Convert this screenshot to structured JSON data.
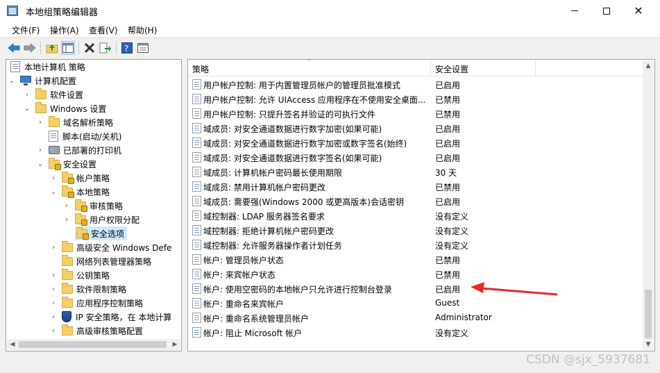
{
  "window": {
    "title": "本地组策略编辑器"
  },
  "menu": [
    "文件(F)",
    "操作(A)",
    "查看(V)",
    "帮助(H)"
  ],
  "toolbar_icons": [
    "back-arrow-icon",
    "forward-arrow-icon",
    "up-folder-icon",
    "show-tree-icon",
    "delete-icon",
    "export-icon",
    "help-icon",
    "properties-icon"
  ],
  "tree": [
    {
      "label": "本地计算机 策略",
      "icon": "policy-icon"
    },
    {
      "label": "计算机配置",
      "icon": "computer-icon"
    },
    {
      "label": "软件设置",
      "icon": "folder-icon"
    },
    {
      "label": "Windows 设置",
      "icon": "folder-icon"
    },
    {
      "label": "域名解析策略",
      "icon": "folder-icon"
    },
    {
      "label": "脚本(启动/关机)",
      "icon": "script-icon"
    },
    {
      "label": "已部署的打印机",
      "icon": "printer-icon"
    },
    {
      "label": "安全设置",
      "icon": "security-folder-icon"
    },
    {
      "label": "帐户策略",
      "icon": "security-folder-icon"
    },
    {
      "label": "本地策略",
      "icon": "security-folder-icon"
    },
    {
      "label": "审核策略",
      "icon": "security-folder-icon"
    },
    {
      "label": "用户权限分配",
      "icon": "security-folder-icon"
    },
    {
      "label": "安全选项",
      "icon": "security-folder-icon"
    },
    {
      "label": "高级安全 Windows Defe",
      "icon": "folder-icon"
    },
    {
      "label": "网络列表管理器策略",
      "icon": "folder-icon"
    },
    {
      "label": "公钥策略",
      "icon": "folder-icon"
    },
    {
      "label": "软件限制策略",
      "icon": "folder-icon"
    },
    {
      "label": "应用程序控制策略",
      "icon": "folder-icon"
    },
    {
      "label": "IP 安全策略，在 本地计算",
      "icon": "shield-icon"
    },
    {
      "label": "高级审核策略配置",
      "icon": "folder-icon"
    }
  ],
  "columns": {
    "policy": "策略",
    "setting": "安全设置"
  },
  "policies": [
    {
      "name": "用户帐户控制: 用于内置管理员帐户的管理员批准模式",
      "value": "已启用"
    },
    {
      "name": "用户帐户控制: 允许 UIAccess 应用程序在不使用安全桌面...",
      "value": "已禁用"
    },
    {
      "name": "用户帐户控制: 只提升签名并验证的可执行文件",
      "value": "已禁用"
    },
    {
      "name": "域成员: 对安全通道数据进行数字加密(如果可能)",
      "value": "已启用"
    },
    {
      "name": "域成员: 对安全通道数据进行数字加密或数字签名(始终)",
      "value": "已启用"
    },
    {
      "name": "域成员: 对安全通道数据进行数字签名(如果可能)",
      "value": "已启用"
    },
    {
      "name": "域成员: 计算机帐户密码最长使用期限",
      "value": "30 天"
    },
    {
      "name": "域成员: 禁用计算机帐户密码更改",
      "value": "已禁用"
    },
    {
      "name": "域成员: 需要强(Windows 2000 或更高版本)会话密钥",
      "value": "已启用"
    },
    {
      "name": "域控制器: LDAP 服务器签名要求",
      "value": "没有定义"
    },
    {
      "name": "域控制器: 拒绝计算机帐户密码更改",
      "value": "没有定义"
    },
    {
      "name": "域控制器: 允许服务器操作者计划任务",
      "value": "没有定义"
    },
    {
      "name": "帐户: 管理员帐户状态",
      "value": "已禁用"
    },
    {
      "name": "帐户: 来宾帐户状态",
      "value": "已禁用"
    },
    {
      "name": "帐户: 使用空密码的本地帐户只允许进行控制台登录",
      "value": "已启用"
    },
    {
      "name": "帐户: 重命名来宾帐户",
      "value": "Guest"
    },
    {
      "name": "帐户: 重命名系统管理员帐户",
      "value": "Administrator"
    },
    {
      "name": "帐户: 阻止 Microsoft 帐户",
      "value": "没有定义"
    }
  ],
  "annotation_color": "#e8282a",
  "watermark": "CSDN @sjx_5937681"
}
